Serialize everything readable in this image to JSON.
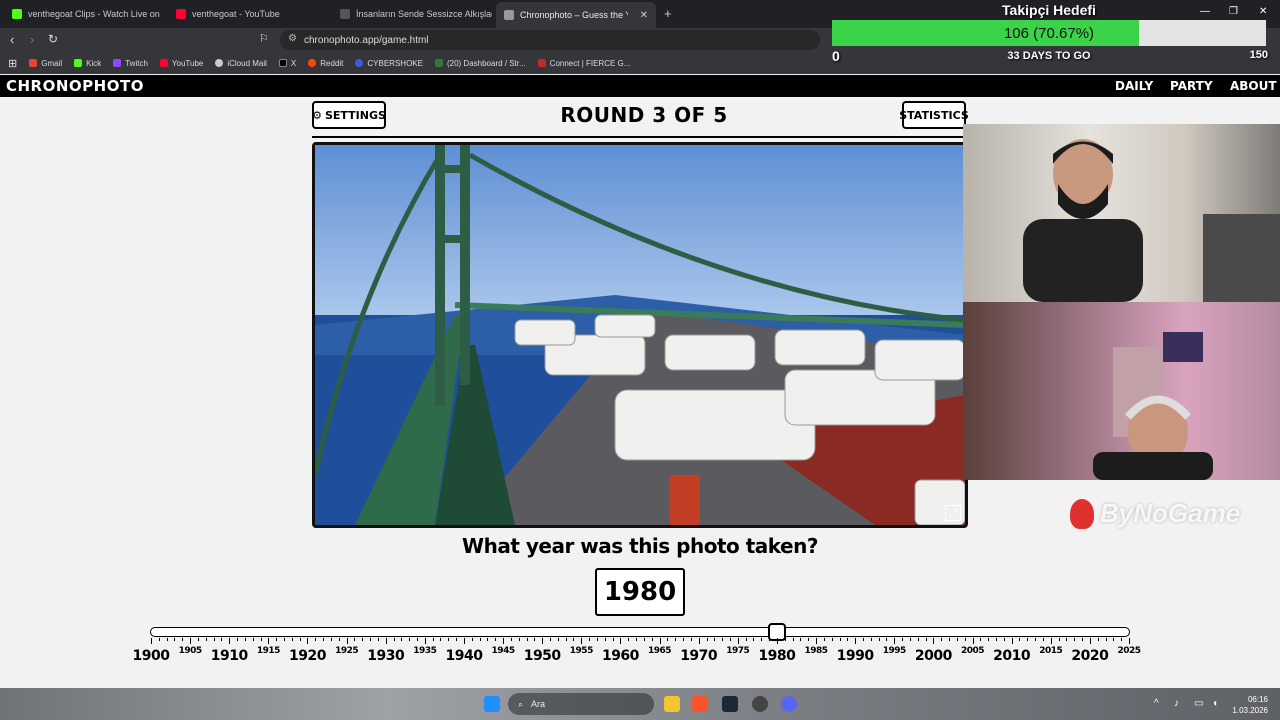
{
  "browser": {
    "tabs": [
      {
        "title": "venthegoat Clips - Watch Live on Kick",
        "active": false,
        "color": "#53fc18"
      },
      {
        "title": "venthegoat - YouTube",
        "active": false,
        "color": "#ff0033"
      },
      {
        "title": "İnsanların Sende Sessizce Alkışladığı",
        "active": false,
        "color": "#222222"
      },
      {
        "title": "Chronophoto – Guess the Year o",
        "active": true,
        "color": "#888888"
      }
    ],
    "url": "chronophoto.app/game.html",
    "bookmarks": [
      {
        "label": "Gmail",
        "color": "#ea4335"
      },
      {
        "label": "Kick",
        "color": "#53fc18"
      },
      {
        "label": "Twitch",
        "color": "#9146ff"
      },
      {
        "label": "YouTube",
        "color": "#ff0033"
      },
      {
        "label": "iCloud Mail",
        "color": "#cccccc"
      },
      {
        "label": "X",
        "color": "#000000"
      },
      {
        "label": "Reddit",
        "color": "#ff4500"
      },
      {
        "label": "CYBERSHOKE",
        "color": "#3b5bdb"
      },
      {
        "label": "(20) Dashboard / Str...",
        "color": "#2e7d32"
      },
      {
        "label": "Connect | FIERCE G...",
        "color": "#c62828"
      }
    ]
  },
  "site": {
    "logo": "CHRONOPHOTO",
    "nav": [
      "DAILY",
      "PARTY",
      "ABOUT"
    ]
  },
  "game": {
    "settings_label": "SETTINGS",
    "statistics_label": "STATISTICS",
    "round_label": "ROUND 3 OF 5",
    "question": "What year was this photo taken?",
    "selected_year": "1980",
    "slider": {
      "min": 1900,
      "max": 2025,
      "value": 1980,
      "major_labels": [
        "1900",
        "1910",
        "1920",
        "1930",
        "1940",
        "1950",
        "1960",
        "1970",
        "1980",
        "1990",
        "2000",
        "2010",
        "2020"
      ],
      "minor_labels": [
        "1905",
        "1915",
        "1925",
        "1935",
        "1945",
        "1955",
        "1965",
        "1975",
        "1985",
        "1995",
        "2005",
        "2015",
        "2025"
      ]
    }
  },
  "overlay": {
    "goal_title": "Takipçi Hedefi",
    "goal_value": "106 (70.67%)",
    "goal_fraction": 0.7067,
    "goal_min": "0",
    "goal_max": "150",
    "goal_days": "33 DAYS TO GO",
    "watermark": "ByNoGame"
  },
  "taskbar": {
    "search_placeholder": "Ara",
    "time": "06:16",
    "date": "1.03.2026"
  }
}
